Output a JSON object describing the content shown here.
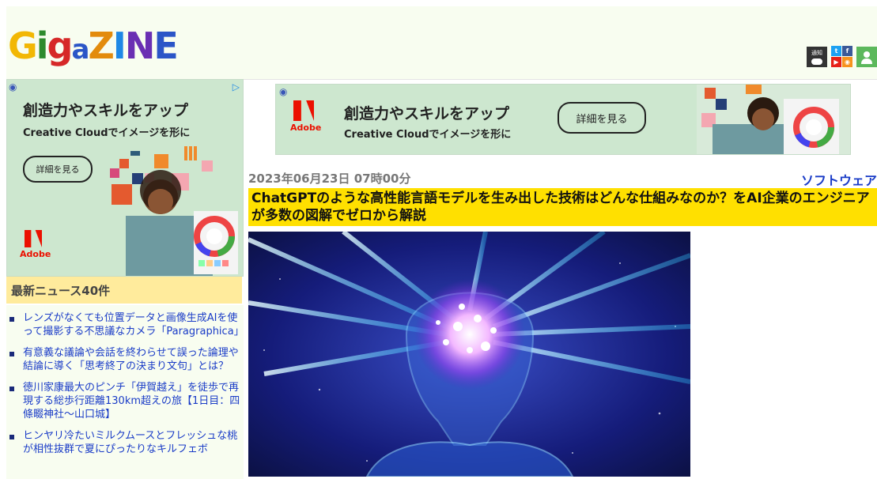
{
  "site": {
    "logo_letters": [
      "G",
      "i",
      "g",
      "a",
      "Z",
      "I",
      "N",
      "E"
    ],
    "icons": [
      {
        "name": "notify-icon",
        "label": "通知"
      },
      {
        "name": "twitter-icon"
      },
      {
        "name": "facebook-icon"
      },
      {
        "name": "youtube-icon"
      },
      {
        "name": "rss-icon"
      },
      {
        "name": "user-icon"
      }
    ]
  },
  "left_ad": {
    "title": "創造力やスキルをアップ",
    "subtitle": "Creative Cloudでイメージを形に",
    "button": "詳細を見る",
    "brand": "Adobe"
  },
  "top_ad": {
    "title": "創造力やスキルをアップ",
    "subtitle": "Creative Cloudでイメージを形に",
    "button": "詳細を見る",
    "brand": "Adobe"
  },
  "news": {
    "heading": "最新ニュース40件",
    "items": [
      "レンズがなくても位置データと画像生成AIを使って撮影する不思議なカメラ「Paragraphica」",
      "有意義な議論や会話を終わらせて誤った論理や結論に導く「思考終了の決まり文句」とは？",
      "徳川家康最大のピンチ「伊賀越え」を徒歩で再現する総歩行距離130km超えの旅【1日目：四條畷神社～山口城】",
      "ヒンヤリ冷たいミルクムースとフレッシュな桃が相性抜群で夏にぴったりなキルフェボ"
    ]
  },
  "article": {
    "date": "2023年06月23日 07時00分",
    "category": "ソフトウェア",
    "title": "ChatGPTのような高性能言語モデルを生み出した技術はどんな仕組みなのか？をAI企業のエンジニアが多数の図解でゼロから解説"
  },
  "colors": {
    "header_bg": "#f8fdf0",
    "title_bg": "#ffe000",
    "news_head_bg": "#ffeb9c",
    "link": "#1a3cc7",
    "ad_bg": "#cde7cf"
  }
}
